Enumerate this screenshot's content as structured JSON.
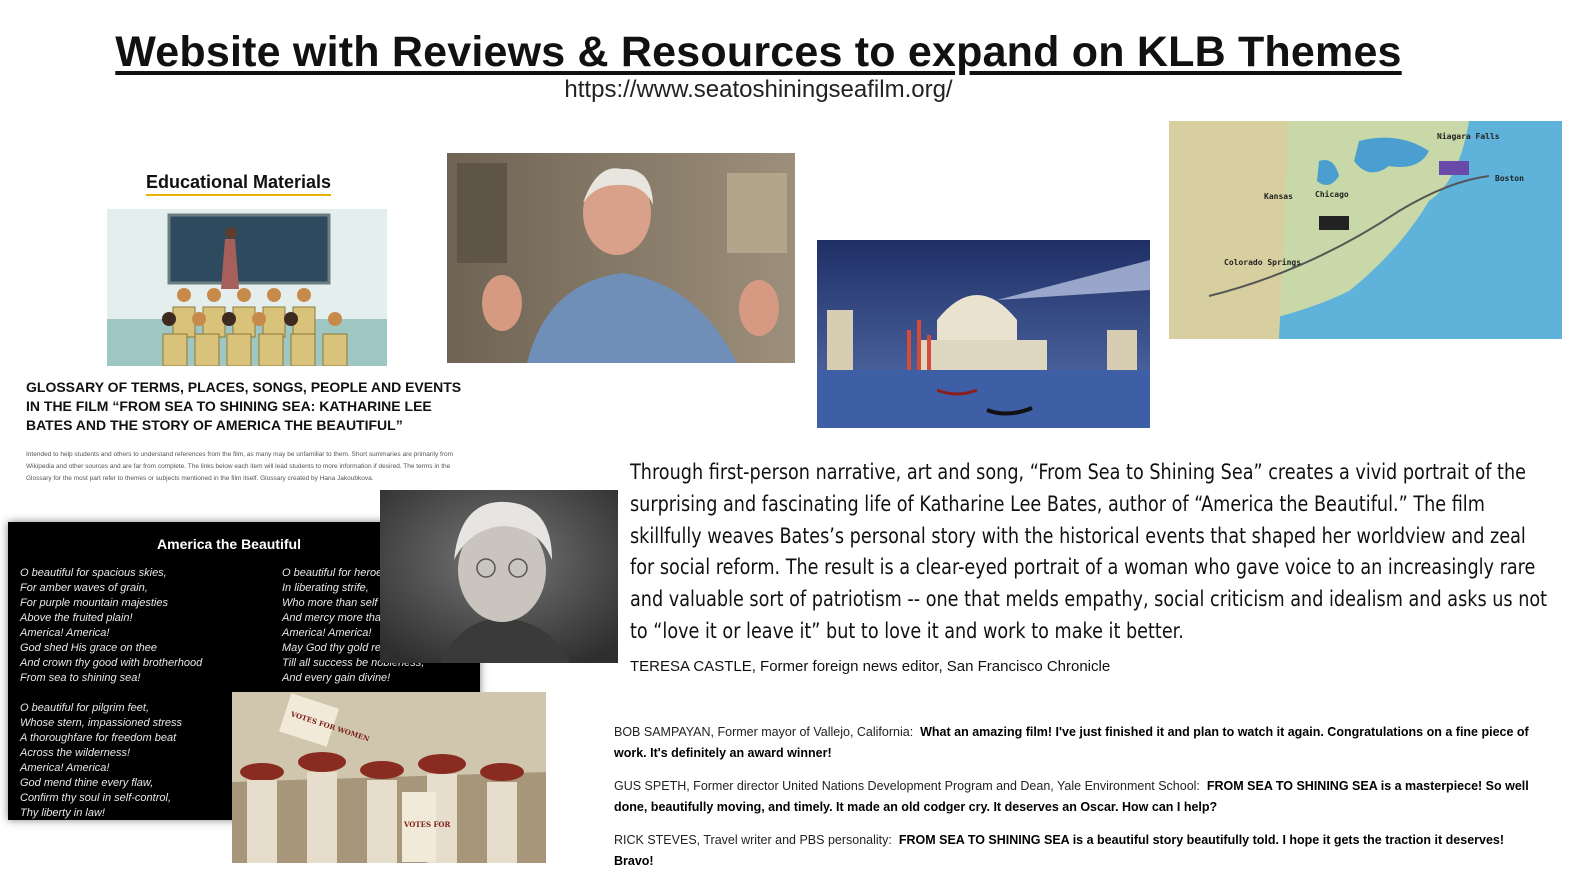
{
  "header": {
    "title": "Website with Reviews & Resources to expand on KLB Themes",
    "url": "https://www.seatoshiningseafilm.org/"
  },
  "educational": {
    "heading": "Educational Materials",
    "glossary_title": "GLOSSARY OF TERMS, PLACES, SONGS, PEOPLE AND EVENTS IN THE FILM “FROM SEA TO SHINING SEA: KATHARINE LEE BATES AND THE STORY OF AMERICA THE BEAUTIFUL”",
    "glossary_body": "Intended to help students and others to understand references from the film, as many may be unfamiliar to them. Short summaries are primarily from Wikipedia and other sources and are far from complete. The links below each item will lead students to more information if desired. The terms in the Glossary for the most part refer to themes or subjects mentioned in the film itself. Glossary created by Hana Jakoubkova."
  },
  "poem": {
    "title": "America the Beautiful",
    "col1": [
      "O beautiful for spacious skies,",
      "For amber waves of grain,",
      "For purple mountain majesties",
      "Above the fruited plain!",
      "America! America!",
      "God shed His grace on thee",
      "And crown thy good with brotherhood",
      "From sea to shining sea!",
      "",
      "O beautiful for pilgrim feet,",
      "Whose stern, impassioned stress",
      "A thoroughfare for freedom beat",
      "Across the wilderness!",
      "America! America!",
      "God mend thine every flaw,",
      "Confirm thy soul in self-control,",
      "Thy liberty in law!"
    ],
    "col2": [
      "O beautiful for heroes proved",
      "In liberating strife,",
      "Who more than self their country loved",
      "And mercy more than life!",
      "America! America!",
      "May God thy gold refine",
      "Till all success be nobleness,",
      "And every gain divine!"
    ]
  },
  "map_labels": {
    "niagara": "Niagara Falls",
    "boston": "Boston",
    "kansas": "Kansas",
    "chicago": "Chicago",
    "colorado": "Colorado Springs"
  },
  "suffrage_signs": {
    "sign1": "VOTES FOR WOMEN",
    "sign2": "VOTES FOR"
  },
  "review_main": {
    "text": "Through first-person narrative, art and song, “From Sea to Shining Sea” creates a vivid portrait of the surprising and fascinating life of Katharine Lee Bates, author of “America the Beautiful.” The film skillfully weaves Bates’s personal story with the historical events that shaped her worldview and zeal for social reform. The result is a clear-eyed portrait of a woman who gave voice to an increasingly rare and valuable sort of patriotism -- one that melds empathy, social criticism and idealism and asks us not to “love it or leave it” but to love it and work to make it better.",
    "author": "TERESA CASTLE, Former foreign news editor, San Francisco Chronicle"
  },
  "quotes": [
    {
      "who": "BOB SAMPAYAN, Former mayor of Vallejo, California:",
      "text": "What an amazing film!  I've just finished it and plan to watch it again. Congratulations on a fine piece of work.  It's definitely an award winner!"
    },
    {
      "who": "GUS SPETH, Former director United Nations Development Program and Dean, Yale Environment School:",
      "text": "FROM SEA TO SHINING SEA is a masterpiece!  So well done, beautifully moving, and timely. It made an old codger cry.  It deserves an Oscar.  How can I help?"
    },
    {
      "who": "RICK STEVES, Travel writer and PBS personality:",
      "text": "FROM SEA TO SHINING SEA is a beautiful story beautifully told.  I hope it gets the traction it deserves! Bravo!"
    }
  ]
}
